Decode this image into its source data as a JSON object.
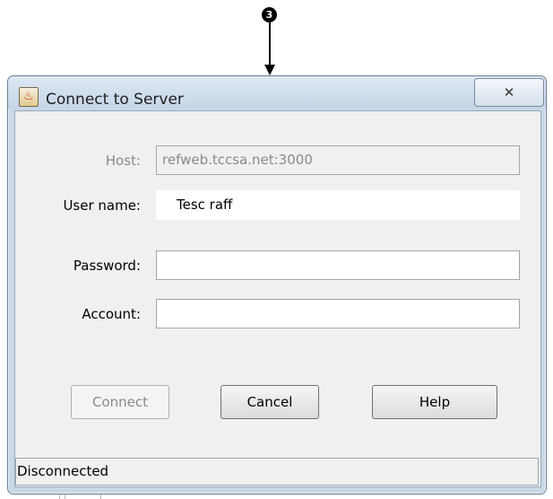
{
  "callout": {
    "number": "3"
  },
  "window": {
    "title": "Connect to Server",
    "close_glyph": "✕",
    "icon": "java-cup-icon"
  },
  "form": {
    "host": {
      "label": "Host:",
      "value": "refweb.tccsa.net:3000",
      "enabled": false
    },
    "username": {
      "label": "User name:",
      "value": "Tesc  raff"
    },
    "password": {
      "label": "Password:",
      "value": ""
    },
    "account": {
      "label": "Account:",
      "value": ""
    }
  },
  "buttons": {
    "connect": "Connect",
    "cancel": "Cancel",
    "help": "Help"
  },
  "status": {
    "text": "Disconnected"
  },
  "colors": {
    "titlebar": "#c6d5e7",
    "client_bg": "#f0f0f0",
    "disabled_text": "#8a8a8a"
  }
}
